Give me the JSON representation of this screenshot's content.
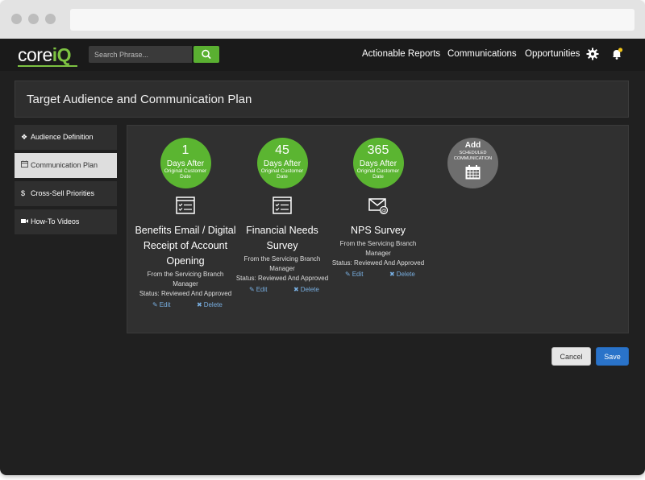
{
  "app": {
    "logo_core": "core",
    "logo_iq": "iQ"
  },
  "search": {
    "placeholder": "Search Phrase..."
  },
  "nav": {
    "items": [
      "Actionable Reports",
      "Communications",
      "Opportunities"
    ]
  },
  "page": {
    "title": "Target Audience and Communication Plan"
  },
  "sidebar": {
    "items": [
      {
        "label": "Audience Definition",
        "icon": "diamond-icon"
      },
      {
        "label": "Communication Plan",
        "icon": "calendar-icon",
        "active": true
      },
      {
        "label": "Cross-Sell Priorities",
        "icon": "dollar-icon"
      },
      {
        "label": "How-To Videos",
        "icon": "video-camera-icon"
      }
    ]
  },
  "communications": [
    {
      "days": "1",
      "days_label": "Days After",
      "sub_label": "Original Customer Date",
      "icon": "checklist-icon",
      "title": "Benefits Email / Digital Receipt of Account Opening",
      "from": "From the Servicing Branch Manager",
      "status": "Status: Reviewed And Approved",
      "edit": "Edit",
      "delete": "Delete"
    },
    {
      "days": "45",
      "days_label": "Days After",
      "sub_label": "Original Customer Date",
      "icon": "checklist-icon",
      "title": "Financial Needs Survey",
      "from": "From the Servicing Branch Manager",
      "status": "Status: Reviewed And Approved",
      "edit": "Edit",
      "delete": "Delete"
    },
    {
      "days": "365",
      "days_label": "Days After",
      "sub_label": "Original Customer Date",
      "icon": "email-icon",
      "title": "NPS Survey",
      "from": "From the Servicing Branch Manager",
      "status": "Status: Reviewed And Approved",
      "edit": "Edit",
      "delete": "Delete"
    }
  ],
  "add_button": {
    "title": "Add",
    "subtitle": "SCHEDULED COMMUNICATION",
    "icon": "calendar-grid-icon"
  },
  "actions": {
    "cancel": "Cancel",
    "save": "Save"
  },
  "colors": {
    "brand_green": "#5bb531",
    "save_blue": "#2a73c9",
    "link_blue": "#78aee0",
    "notification_yellow": "#f0c419"
  }
}
